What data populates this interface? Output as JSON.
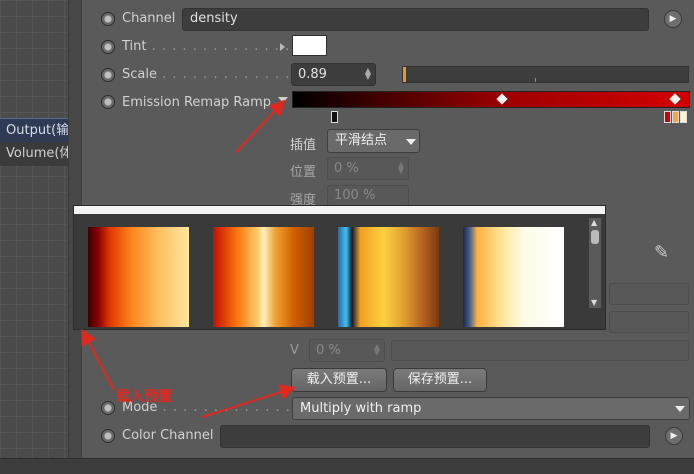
{
  "left_nodes": [
    "Output(输",
    "Volume(体"
  ],
  "properties": {
    "channel": {
      "label": "Channel",
      "value": "density"
    },
    "tint": {
      "label": "Tint",
      "color": "#ffffff"
    },
    "scale": {
      "label": "Scale",
      "value": "0.89"
    },
    "emission_ramp": {
      "label": "Emission Remap Ramp"
    },
    "interpolation": {
      "label": "插值",
      "value": "平滑结点"
    },
    "position": {
      "label": "位置",
      "value": "0 %"
    },
    "intensity": {
      "label": "强度",
      "value": "100 %"
    },
    "v": {
      "label": "V",
      "value": "0 %"
    },
    "load_preset_button": "载入预置...",
    "save_preset_button": "保存预置...",
    "mode": {
      "label": "Mode",
      "value": "Multiply with ramp"
    },
    "color_channel": {
      "label": "Color Channel",
      "value": ""
    }
  },
  "annotation": "载入预置",
  "colors": {
    "accent_arrow": "#e0281e",
    "ramp_dark": "#000000",
    "ramp_red": "#d20000"
  },
  "preset_swatches": [
    {
      "name": "preset-1"
    },
    {
      "name": "preset-2"
    },
    {
      "name": "preset-3"
    },
    {
      "name": "preset-4"
    }
  ]
}
